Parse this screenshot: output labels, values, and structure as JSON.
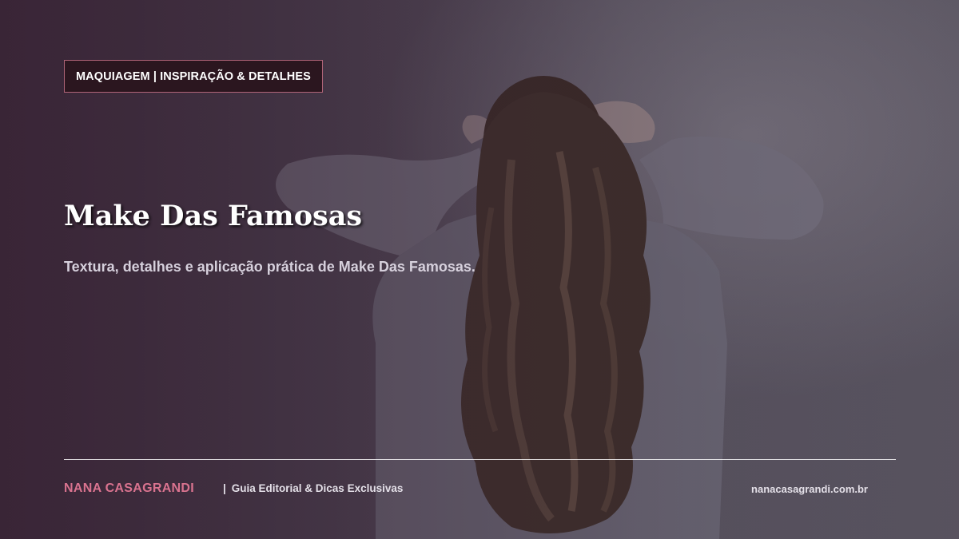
{
  "hero": {
    "category": "MAQUIAGEM | INSPIRAÇÃO & DETALHES",
    "title": "Make Das Famosas",
    "subtitle": "Textura, detalhes e aplicação prática de Make Das Famosas."
  },
  "footer": {
    "brand": "NANA CASAGRANDI",
    "separator": "|",
    "tagline": "Guia Editorial & Dicas Exclusivas",
    "url": "nanacasagrandi.com.br"
  },
  "colors": {
    "accent": "#d9738f",
    "badge_bg": "#2b161f",
    "badge_border": "#b06478"
  }
}
